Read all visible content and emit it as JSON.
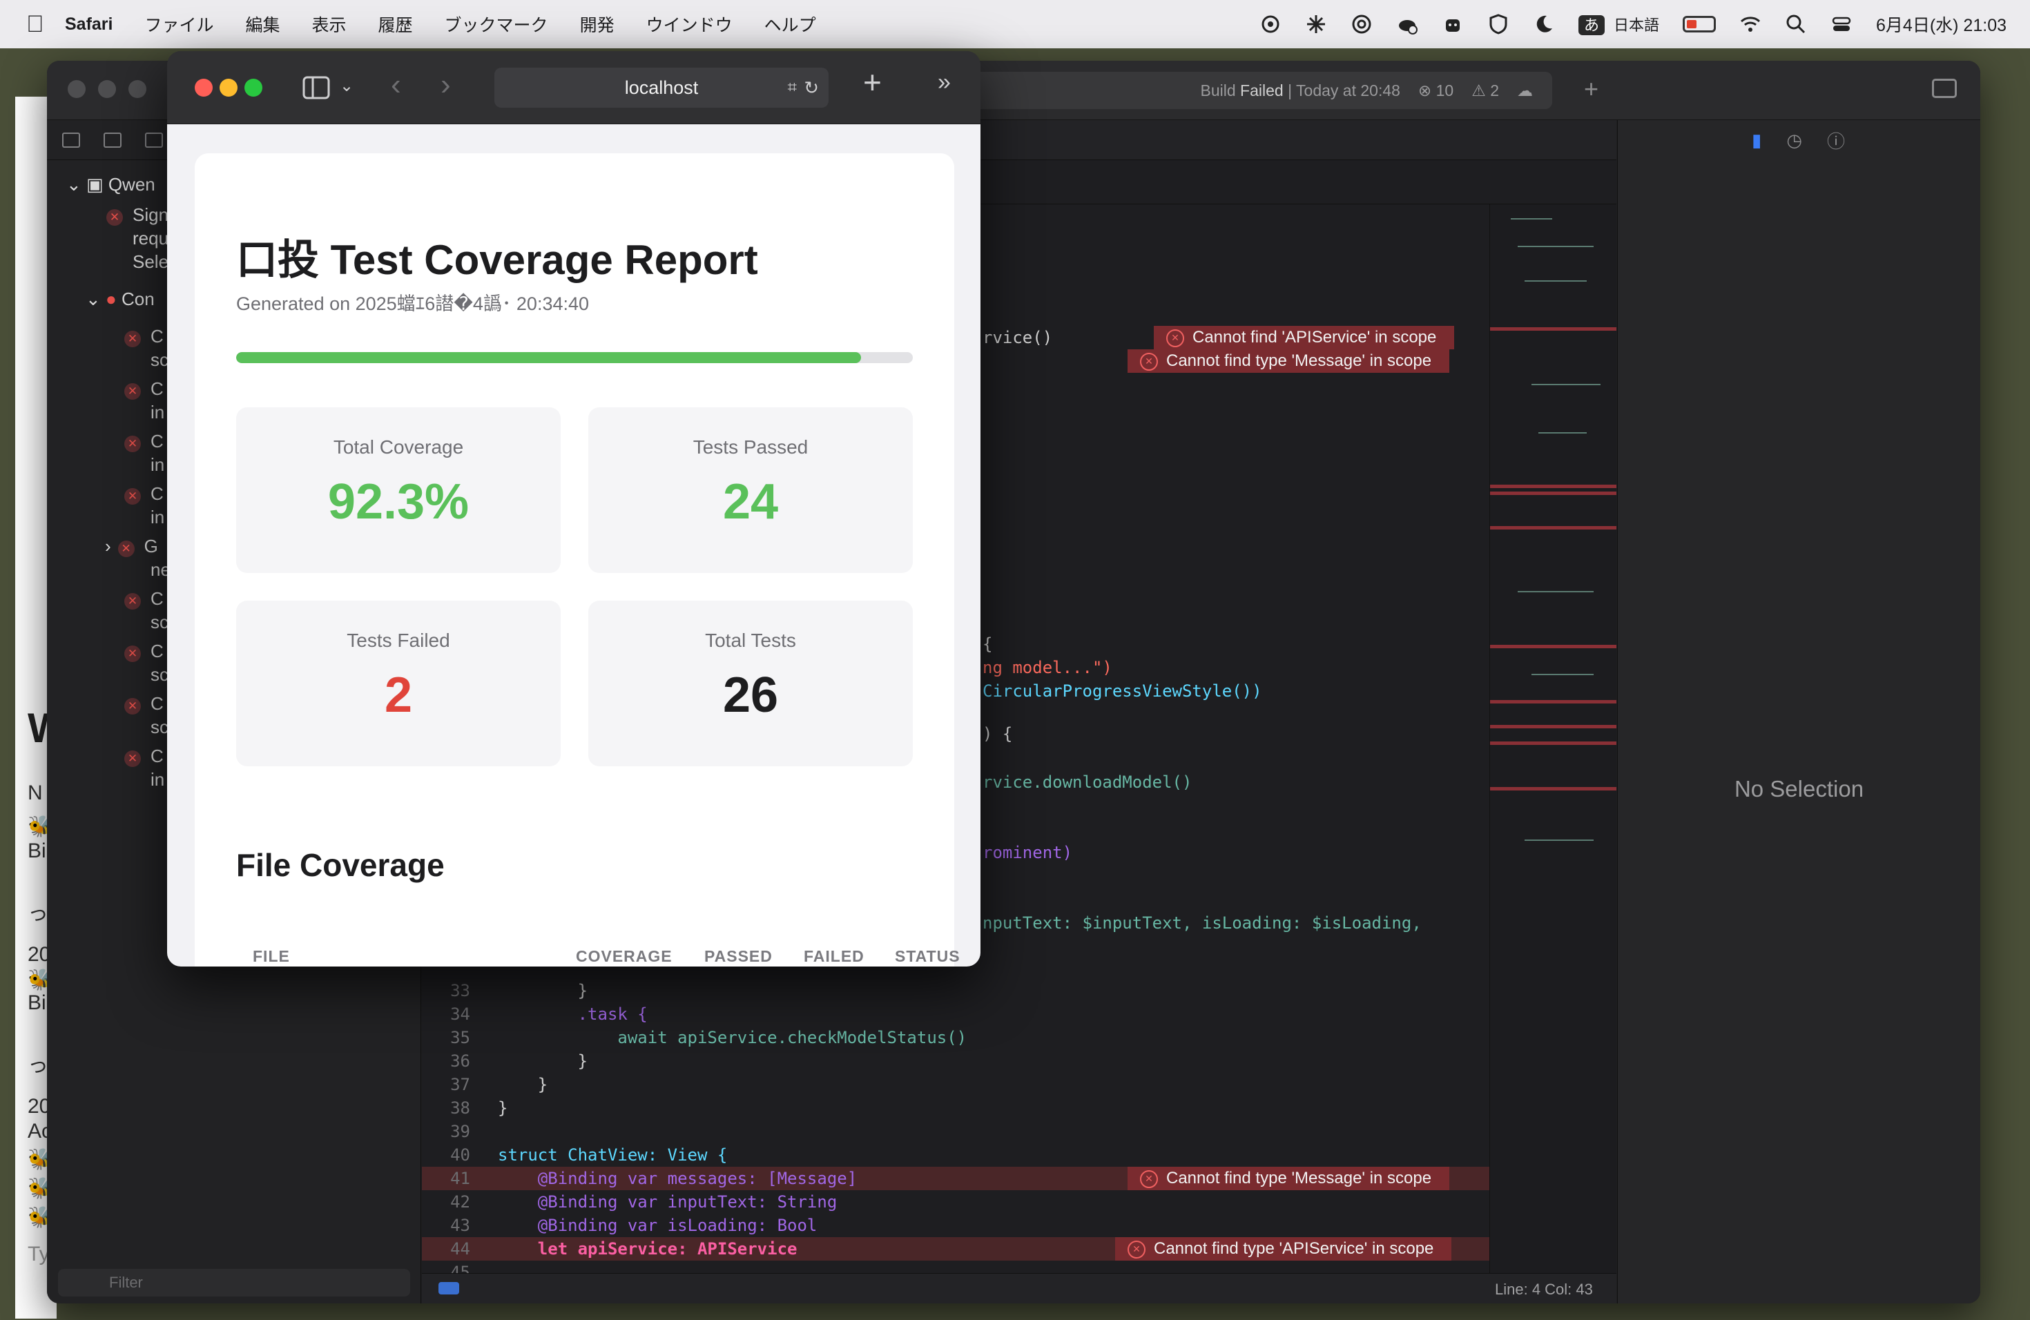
{
  "menubar": {
    "app": "Safari",
    "items": [
      "ファイル",
      "編集",
      "表示",
      "履歴",
      "ブックマーク",
      "開発",
      "ウインドウ",
      "ヘルプ"
    ],
    "ime": "あ",
    "ime_lang": "日本語",
    "datetime": "6月4日(水)  21:03"
  },
  "back_app": {
    "frag_w": "W",
    "frag_n": "N",
    "frag_b1": "Bi",
    "frag_tsu1": "っ",
    "frag_20a": "20",
    "frag_b2": "Bi",
    "frag_tsu2": "っ",
    "frag_20b": "20",
    "frag_ac": "Ac",
    "frag_ty": "Ty"
  },
  "xcode": {
    "build_label": "Build",
    "build_state": "Failed",
    "build_time": "| Today at 20:48",
    "error_count": "10",
    "warning_count": "2",
    "navigator": {
      "root": "Qwen",
      "issue1": [
        "Sign",
        "requ",
        "Sele"
      ],
      "group": "Con",
      "rows": [
        [
          "C",
          "sc"
        ],
        [
          "C",
          "in"
        ],
        [
          "C",
          "in"
        ],
        [
          "C",
          "in"
        ],
        [
          "G",
          "ne"
        ],
        [
          "C",
          "sc"
        ],
        [
          "C",
          "sc"
        ],
        [
          "C",
          "sc"
        ],
        [
          "C",
          "in"
        ]
      ],
      "filter_placeholder": "Filter"
    },
    "code_fragments": {
      "l1": "rvice()",
      "l2": "{",
      "l3": "ng model...\")",
      "l4": "CircularProgressViewStyle())",
      "l5": ") {",
      "l6": "rvice.downloadModel()",
      "l7": "rominent)",
      "l8": "nputText: $inputText, isLoading: $isLoading,"
    },
    "code_lines": [
      {
        "n": "33",
        "text": "        }"
      },
      {
        "n": "34",
        "text": "        .task {"
      },
      {
        "n": "35",
        "text": "            await apiService.checkModelStatus()"
      },
      {
        "n": "36",
        "text": "        }"
      },
      {
        "n": "37",
        "text": "    }"
      },
      {
        "n": "38",
        "text": "}"
      },
      {
        "n": "39",
        "text": ""
      },
      {
        "n": "40",
        "text": "struct ChatView: View {"
      },
      {
        "n": "41",
        "text": "    @Binding var messages: [Message]"
      },
      {
        "n": "42",
        "text": "    @Binding var inputText: String"
      },
      {
        "n": "43",
        "text": "    @Binding var isLoading: Bool"
      },
      {
        "n": "44",
        "text": "    let apiService: APIService"
      },
      {
        "n": "45",
        "text": ""
      }
    ],
    "errors": {
      "e1": "Cannot find 'APIService' in scope",
      "e2": "Cannot find type 'Message' in scope",
      "e3": "Cannot find type 'Message' in scope",
      "e4": "Cannot find type 'APIService' in scope"
    },
    "status_line": "Line: 4  Col: 43",
    "inspector_empty": "No Selection"
  },
  "safari": {
    "address": "localhost",
    "report": {
      "title": "口投 Test Coverage Report",
      "generated": "Generated on 2025蟷ｴ6譛�4譌･ 20:34:40",
      "progress": 0.923,
      "stats": [
        {
          "label": "Total Coverage",
          "value": "92.3%",
          "color": "#5ac05a"
        },
        {
          "label": "Tests Passed",
          "value": "24",
          "color": "#5ac05a"
        },
        {
          "label": "Tests Failed",
          "value": "2",
          "color": "#e0443a"
        },
        {
          "label": "Total Tests",
          "value": "26",
          "color": "#1d1d1f"
        }
      ],
      "section": "File Coverage",
      "columns": [
        "FILE",
        "COVERAGE",
        "PASSED",
        "FAILED",
        "STATUS"
      ]
    }
  }
}
